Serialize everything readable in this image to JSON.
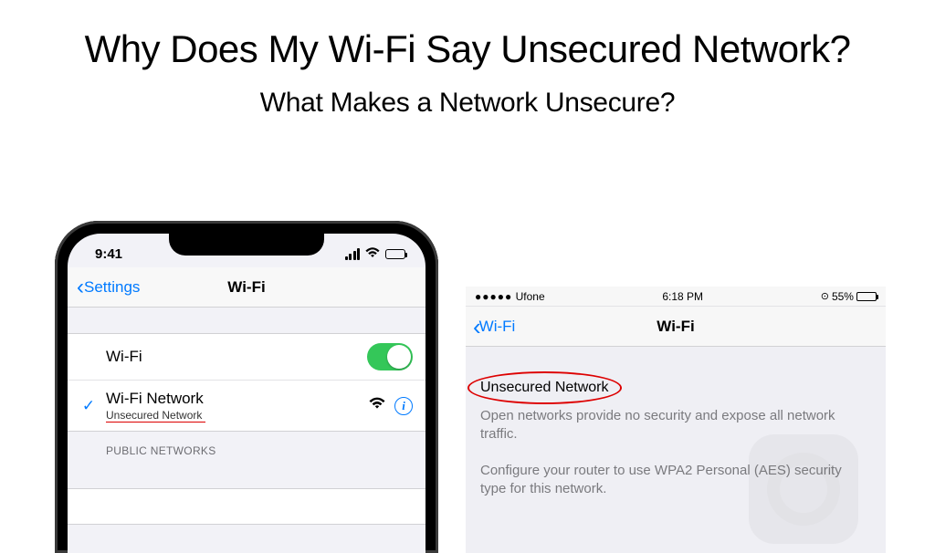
{
  "headings": {
    "main": "Why Does My Wi-Fi Say Unsecured Network?",
    "sub": "What Makes a Network Unsecure?"
  },
  "phone_left": {
    "status": {
      "time": "9:41"
    },
    "nav": {
      "back_label": "Settings",
      "title": "Wi-Fi"
    },
    "wifi_toggle_row": {
      "label": "Wi-Fi",
      "on": true
    },
    "connected_row": {
      "label": "Wi-Fi Network",
      "sublabel": "Unsecured Network"
    },
    "section_header": "PUBLIC NETWORKS"
  },
  "phone_right": {
    "status": {
      "carrier": "Ufone",
      "time": "6:18 PM",
      "battery_pct": "55%"
    },
    "nav": {
      "back_label": "Wi-Fi",
      "title": "Wi-Fi"
    },
    "detail": {
      "heading": "Unsecured Network",
      "para1": "Open networks provide no security and expose all network traffic.",
      "para2": "Configure your router to use WPA2 Personal (AES) security type for this network."
    }
  }
}
